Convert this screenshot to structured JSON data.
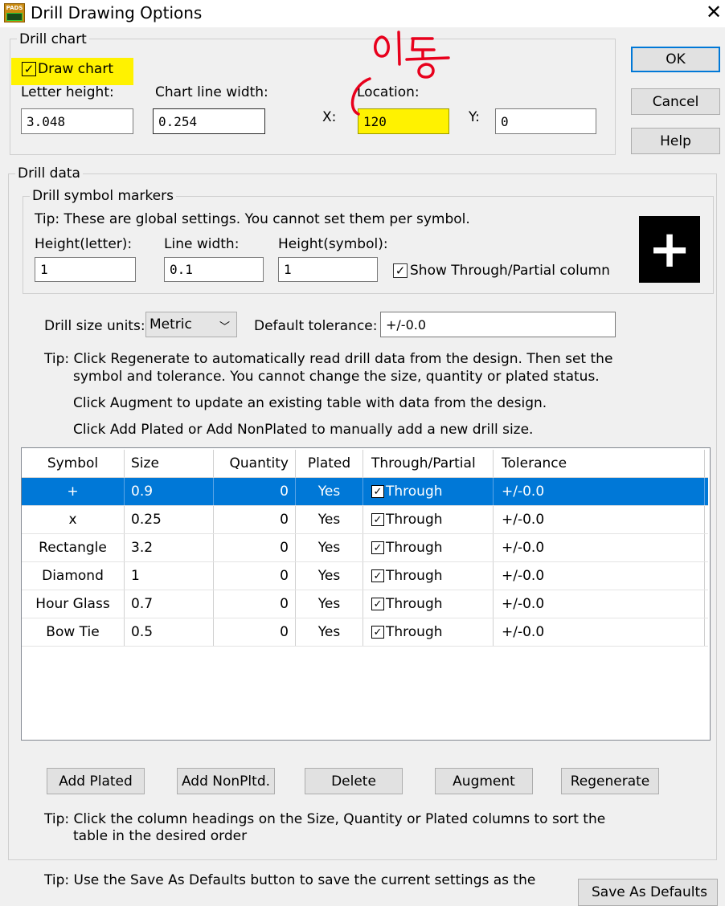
{
  "window": {
    "title": "Drill Drawing Options",
    "app_icon_text": "PADS"
  },
  "drill_chart": {
    "group_label": "Drill chart",
    "draw_chart_label": "Draw chart",
    "draw_chart_checked": true,
    "letter_height_label": "Letter height:",
    "letter_height_value": "3.048",
    "chart_line_width_label": "Chart line width:",
    "chart_line_width_value": "0.254",
    "location_label": "Location:",
    "x_label": "X:",
    "x_value": "120",
    "y_label": "Y:",
    "y_value": "0"
  },
  "annotation": {
    "handwritten_text": "이동",
    "color": "#e8001c",
    "highlight_color": "#fff200"
  },
  "buttons": {
    "ok": "OK",
    "cancel": "Cancel",
    "help": "Help",
    "add_plated": "Add Plated",
    "add_nonpltd": "Add NonPltd.",
    "delete": "Delete",
    "augment": "Augment",
    "regenerate": "Regenerate",
    "save_as_defaults": "Save As Defaults"
  },
  "drill_data": {
    "group_label": "Drill data",
    "symbol_markers": {
      "group_label": "Drill symbol markers",
      "tip": "Tip: These are global settings. You cannot set them per symbol.",
      "height_letter_label": "Height(letter):",
      "height_letter_value": "1",
      "line_width_label": "Line width:",
      "line_width_value": "0.1",
      "height_symbol_label": "Height(symbol):",
      "height_symbol_value": "1",
      "show_through_label": "Show Through/Partial column",
      "show_through_checked": true,
      "preview_symbol": "+"
    },
    "size_units_label": "Drill size units:",
    "size_units_value": "Metric",
    "default_tolerance_label": "Default tolerance:",
    "default_tolerance_value": "+/-0.0",
    "tip1_line1": "Tip: Click Regenerate to automatically read drill data from the design. Then set the",
    "tip1_line2": "symbol and tolerance. You cannot change the size, quantity or plated status.",
    "tip2": "Click Augment to update an existing table with data from the design.",
    "tip3": "Click Add Plated or Add NonPlated to manually add a new drill size.",
    "tip_sort_line1": "Tip: Click the column headings on the Size, Quantity or Plated columns to sort the",
    "tip_sort_line2": "table in the desired order",
    "tip_defaults": "Tip: Use the Save As Defaults button to save the current settings as the"
  },
  "table": {
    "columns": [
      "Symbol",
      "Size",
      "Quantity",
      "Plated",
      "Through/Partial",
      "Tolerance"
    ],
    "selected_row": 0,
    "rows": [
      {
        "symbol": "+",
        "size": "0.9",
        "quantity": "0",
        "plated": "Yes",
        "through": "Through",
        "tolerance": "+/-0.0"
      },
      {
        "symbol": "x",
        "size": "0.25",
        "quantity": "0",
        "plated": "Yes",
        "through": "Through",
        "tolerance": "+/-0.0"
      },
      {
        "symbol": "Rectangle",
        "size": "3.2",
        "quantity": "0",
        "plated": "Yes",
        "through": "Through",
        "tolerance": "+/-0.0"
      },
      {
        "symbol": "Diamond",
        "size": "1",
        "quantity": "0",
        "plated": "Yes",
        "through": "Through",
        "tolerance": "+/-0.0"
      },
      {
        "symbol": "Hour Glass",
        "size": "0.7",
        "quantity": "0",
        "plated": "Yes",
        "through": "Through",
        "tolerance": "+/-0.0"
      },
      {
        "symbol": "Bow Tie",
        "size": "0.5",
        "quantity": "0",
        "plated": "Yes",
        "through": "Through",
        "tolerance": "+/-0.0"
      }
    ]
  },
  "icons": {
    "close": "close-icon",
    "checkbox_check": "✓",
    "dropdown": "chevron-down-icon"
  }
}
